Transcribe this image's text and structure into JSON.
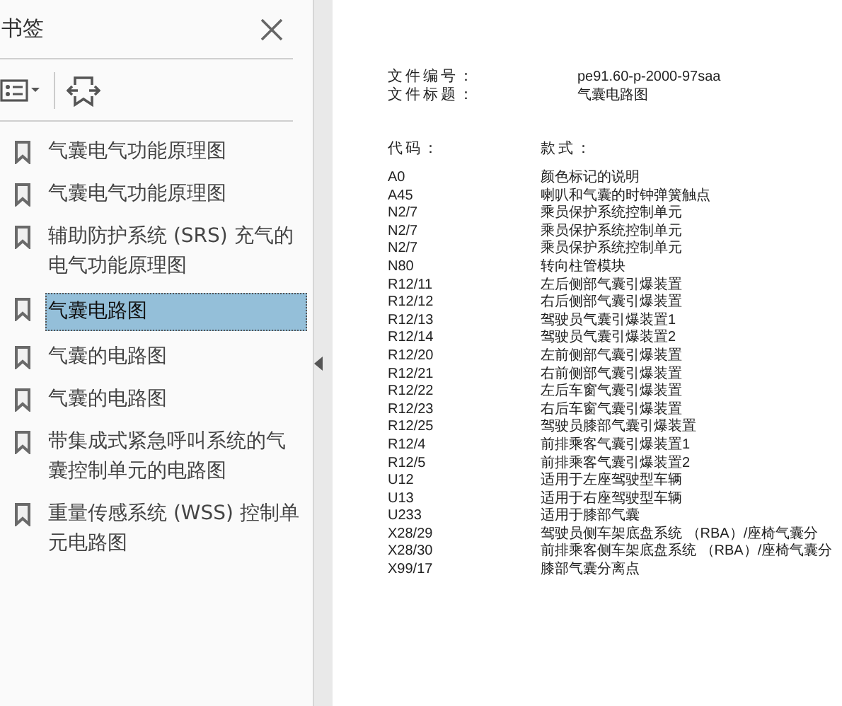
{
  "sidebar": {
    "title": "书签",
    "items": [
      {
        "label": "气囊电气功能原理图",
        "selected": false
      },
      {
        "label": "气囊电气功能原理图",
        "selected": false
      },
      {
        "label": "辅助防护系统 (SRS) 充气的电气功能原理图",
        "selected": false
      },
      {
        "label": "气囊电路图",
        "selected": true
      },
      {
        "label": "气囊的电路图",
        "selected": false
      },
      {
        "label": "气囊的电路图",
        "selected": false
      },
      {
        "label": "带集成式紧急呼叫系统的气囊控制单元的电路图",
        "selected": false
      },
      {
        "label": "重量传感系统 (WSS) 控制单元电路图",
        "selected": false
      }
    ]
  },
  "document": {
    "fields": [
      {
        "label": "文件编号：",
        "value": "pe91.60-p-2000-97saa"
      },
      {
        "label": "文件标题：",
        "value": "气囊电路图"
      }
    ],
    "headers": [
      "代码：",
      "款式："
    ],
    "rows": [
      {
        "code": "A0",
        "description": "颜色标记的说明"
      },
      {
        "code": "A45",
        "description": "喇叭和气囊的时钟弹簧触点"
      },
      {
        "code": "N2/7",
        "description": "乘员保护系统控制单元"
      },
      {
        "code": "N2/7",
        "description": "乘员保护系统控制单元"
      },
      {
        "code": "N2/7",
        "description": "乘员保护系统控制单元"
      },
      {
        "code": "N80",
        "description": "转向柱管模块"
      },
      {
        "code": "R12/11",
        "description": "左后侧部气囊引爆装置"
      },
      {
        "code": "R12/12",
        "description": "右后侧部气囊引爆装置"
      },
      {
        "code": "R12/13",
        "description": "驾驶员气囊引爆装置1"
      },
      {
        "code": "R12/14",
        "description": "驾驶员气囊引爆装置2"
      },
      {
        "code": "R12/20",
        "description": "左前侧部气囊引爆装置"
      },
      {
        "code": "R12/21",
        "description": "右前侧部气囊引爆装置"
      },
      {
        "code": "R12/22",
        "description": "左后车窗气囊引爆装置"
      },
      {
        "code": "R12/23",
        "description": "右后车窗气囊引爆装置"
      },
      {
        "code": "R12/25",
        "description": "驾驶员膝部气囊引爆装置"
      },
      {
        "code": "R12/4",
        "description": "前排乘客气囊引爆装置1"
      },
      {
        "code": "R12/5",
        "description": "前排乘客气囊引爆装置2"
      },
      {
        "code": "U12",
        "description": "适用于左座驾驶型车辆"
      },
      {
        "code": "U13",
        "description": "适用于右座驾驶型车辆"
      },
      {
        "code": "U233",
        "description": "适用于膝部气囊"
      },
      {
        "code": "X28/29",
        "description": "驾驶员侧车架底盘系统 （RBA）/座椅气囊分"
      },
      {
        "code": "X28/30",
        "description": "前排乘客侧车架底盘系统 （RBA）/座椅气囊分"
      },
      {
        "code": "X99/17",
        "description": "膝部气囊分离点"
      }
    ]
  }
}
